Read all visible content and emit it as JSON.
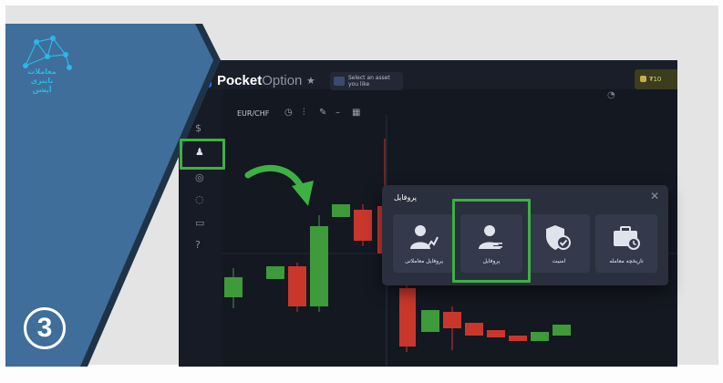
{
  "brand": {
    "text": "معاملات باینری آپشن",
    "accent": "#2bb7e8"
  },
  "step": {
    "number": "3"
  },
  "platform": {
    "logo_bold": "Pocket",
    "logo_light": "Option",
    "promo_text": "Select an asset you like",
    "account_text": "₮10",
    "pair": "EUR/CHF"
  },
  "popup": {
    "title": "پروفایل",
    "close": "✕",
    "items": [
      {
        "label": "پروفایل معاملاتی",
        "icon": "trading-profile-icon"
      },
      {
        "label": "پروفایل",
        "icon": "user-profile-icon",
        "highlighted": true
      },
      {
        "label": "امنیت",
        "icon": "shield-check-icon"
      },
      {
        "label": "تاریخچه معامله",
        "icon": "briefcase-history-icon"
      }
    ]
  },
  "colors": {
    "highlight": "#3fb044",
    "up": "#3e9a3a",
    "down": "#c9372c",
    "panel": "#2a2f3d",
    "blue_overlay": "#3f6e9a"
  }
}
